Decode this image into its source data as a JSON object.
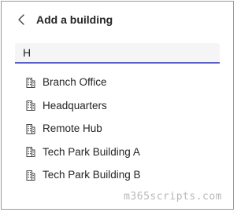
{
  "header": {
    "title": "Add a building",
    "back_icon": "chevron-left-icon"
  },
  "search": {
    "value": "H"
  },
  "buildings": [
    {
      "label": "Branch Office",
      "icon": "building-icon"
    },
    {
      "label": "Headquarters",
      "icon": "building-icon"
    },
    {
      "label": "Remote Hub",
      "icon": "building-icon"
    },
    {
      "label": "Tech Park Building A",
      "icon": "building-icon"
    },
    {
      "label": "Tech Park Building B",
      "icon": "building-icon"
    }
  ],
  "watermark": "m365scripts.com",
  "colors": {
    "accent": "#5b5fc7",
    "border": "#9a9a9a",
    "input_bg": "#f5f5f5",
    "text": "#242424"
  }
}
